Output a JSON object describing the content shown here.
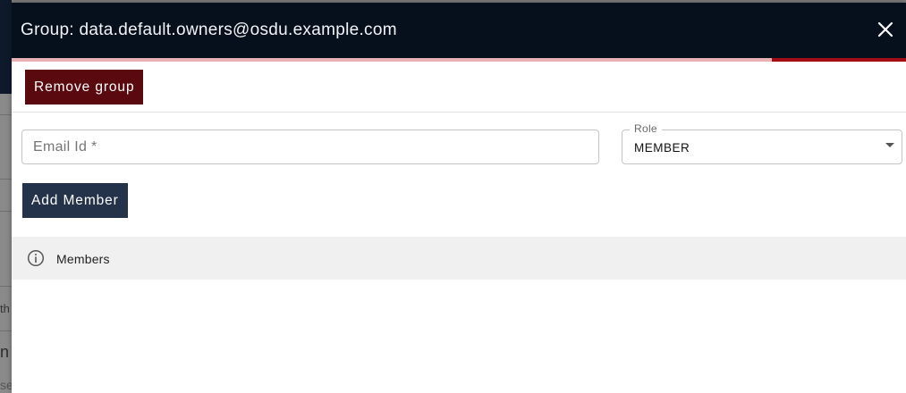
{
  "background": {
    "fragments": [
      "th",
      "n in",
      "se"
    ]
  },
  "dialog": {
    "title": "Group: data.default.owners@osdu.example.com",
    "close_icon": "close-icon",
    "progress": 0.15,
    "remove_button_label": "Remove group",
    "email_field": {
      "placeholder": "Email Id *",
      "value": ""
    },
    "role_field": {
      "label": "Role",
      "selected": "MEMBER"
    },
    "add_button_label": "Add Member",
    "members": {
      "icon": "info-icon",
      "label": "Members"
    }
  },
  "colors": {
    "header_bg": "#06101c",
    "remove_button": "#5a0a0f",
    "add_button": "#243349",
    "progress_fill": "#a30c14",
    "progress_track": "#e8b1b3"
  }
}
